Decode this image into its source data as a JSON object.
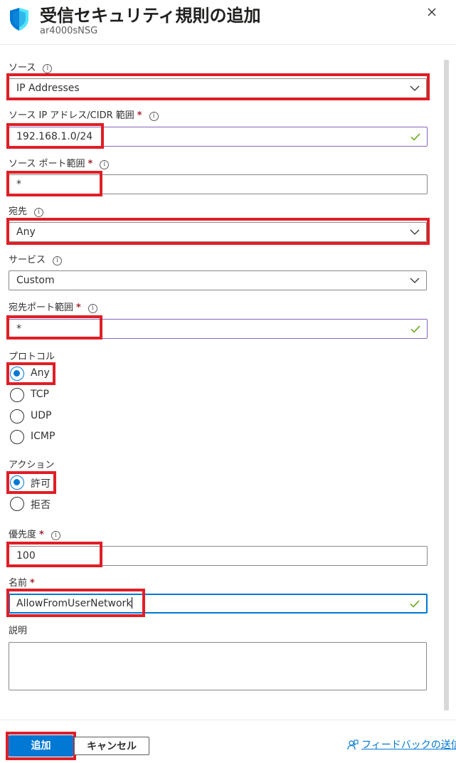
{
  "header": {
    "title": "受信セキュリティ規則の追加",
    "subtitle": "ar4000sNSG"
  },
  "form": {
    "source": {
      "label": "ソース",
      "value": "IP Addresses"
    },
    "source_ip": {
      "label": "ソース IP アドレス/CIDR 範囲",
      "required": "*",
      "value": "192.168.1.0/24"
    },
    "source_port": {
      "label": "ソース ポート範囲",
      "required": "*",
      "value": "*"
    },
    "destination": {
      "label": "宛先",
      "value": "Any"
    },
    "service": {
      "label": "サービス",
      "value": "Custom"
    },
    "dest_port": {
      "label": "宛先ポート範囲",
      "required": "*",
      "value": "*"
    },
    "protocol": {
      "label": "プロトコル",
      "options": [
        "Any",
        "TCP",
        "UDP",
        "ICMP"
      ],
      "selected": "Any"
    },
    "action": {
      "label": "アクション",
      "options": [
        "許可",
        "拒否"
      ],
      "selected": "許可"
    },
    "priority": {
      "label": "優先度",
      "required": "*",
      "value": "100"
    },
    "name": {
      "label": "名前",
      "required": "*",
      "value": "AllowFromUserNetwork"
    },
    "description": {
      "label": "説明",
      "value": ""
    }
  },
  "footer": {
    "add_label": "追加",
    "cancel_label": "キャンセル",
    "feedback_label": "フィードバックの送信"
  },
  "info_glyph": "i",
  "colors": {
    "accent": "#0078d4",
    "highlight": "#e01e26",
    "valid": "#57a300",
    "required": "#a4262c"
  },
  "icons": [
    "shield-icon",
    "close-icon",
    "info-icon",
    "chevron-down-icon",
    "checkmark-icon",
    "feedback-icon"
  ]
}
